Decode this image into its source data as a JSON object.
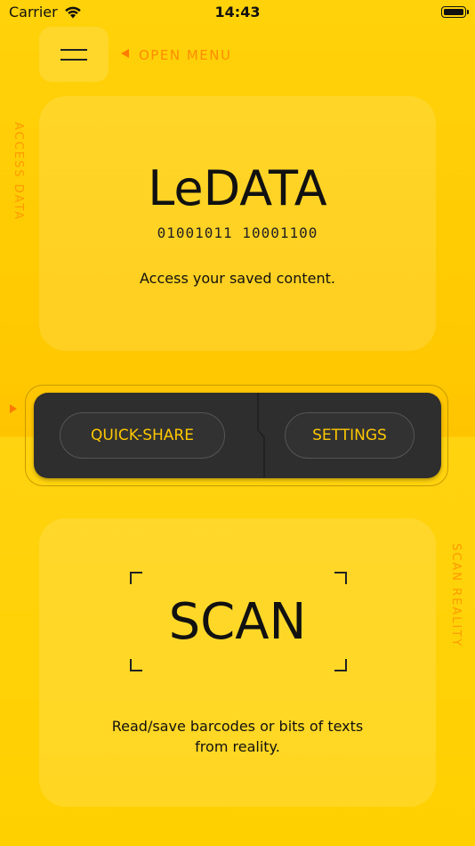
{
  "status_bar": {
    "carrier": "Carrier",
    "time": "14:43"
  },
  "menu": {
    "open_label": "OPEN MENU"
  },
  "side_labels": {
    "left": "ACCESS DATA",
    "right": "SCAN REALITY"
  },
  "data_card": {
    "logo": "LeDATA",
    "binary": "01001011 10001100",
    "description": "Access your saved content."
  },
  "controls": {
    "quick_share_label": "QUICK-SHARE",
    "settings_label": "SETTINGS"
  },
  "scan_card": {
    "title": "SCAN",
    "description_line1": "Read/save barcodes or bits of texts",
    "description_line2": "from reality."
  },
  "colors": {
    "background": "#FFCC00",
    "accent_orange": "#FF8C00",
    "panel_dark": "#2E2E2E",
    "button_text": "#FFC800"
  },
  "icons": [
    "wifi-icon",
    "battery-icon",
    "hamburger-menu-icon",
    "arrow-left-icon",
    "arrow-right-icon",
    "scan-frame-corners"
  ]
}
